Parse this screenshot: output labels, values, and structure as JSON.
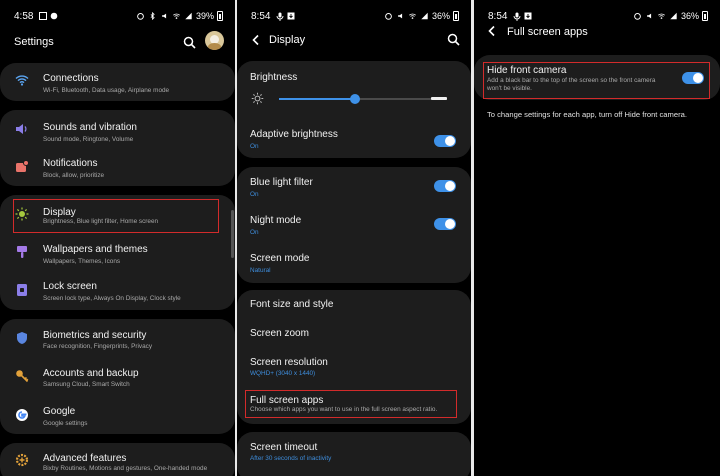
{
  "colors": {
    "accent": "#3e91e8",
    "highlight": "#d22b2b",
    "card": "#1d1d1d"
  },
  "panel1": {
    "status": {
      "time": "4:58",
      "battery": "39%"
    },
    "title": "Settings",
    "items": [
      {
        "title": "Connections",
        "subtitle": "Wi-Fi, Bluetooth, Data usage, Airplane mode",
        "icon": "wifi-icon"
      },
      {
        "title": "Sounds and vibration",
        "subtitle": "Sound mode, Ringtone, Volume",
        "icon": "volume-icon"
      },
      {
        "title": "Notifications",
        "subtitle": "Block, allow, prioritize",
        "icon": "notification-icon"
      },
      {
        "title": "Display",
        "subtitle": "Brightness, Blue light filter, Home screen",
        "icon": "sun-icon"
      },
      {
        "title": "Wallpapers and themes",
        "subtitle": "Wallpapers, Themes, Icons",
        "icon": "brush-icon"
      },
      {
        "title": "Lock screen",
        "subtitle": "Screen lock type, Always On Display, Clock style",
        "icon": "lock-icon"
      },
      {
        "title": "Biometrics and security",
        "subtitle": "Face recognition, Fingerprints, Privacy",
        "icon": "shield-icon"
      },
      {
        "title": "Accounts and backup",
        "subtitle": "Samsung Cloud, Smart Switch",
        "icon": "key-icon"
      },
      {
        "title": "Google",
        "subtitle": "Google settings",
        "icon": "google-icon"
      },
      {
        "title": "Advanced features",
        "subtitle": "Bixby Routines, Motions and gestures, One-handed mode",
        "icon": "gear-plus-icon"
      }
    ]
  },
  "panel2": {
    "status": {
      "time": "8:54",
      "battery": "36%"
    },
    "title": "Display",
    "brightness": {
      "label": "Brightness",
      "level": 0.45
    },
    "adaptive": {
      "title": "Adaptive brightness",
      "subtitle": "On"
    },
    "blue_light": {
      "title": "Blue light filter",
      "subtitle": "On"
    },
    "night_mode": {
      "title": "Night mode",
      "subtitle": "On"
    },
    "screen_mode": {
      "title": "Screen mode",
      "subtitle": "Natural"
    },
    "font_size": {
      "title": "Font size and style"
    },
    "screen_zoom": {
      "title": "Screen zoom"
    },
    "resolution": {
      "title": "Screen resolution",
      "subtitle": "WQHD+ (3040 x 1440)"
    },
    "full_screen": {
      "title": "Full screen apps",
      "subtitle": "Choose which apps you want to use in the full screen aspect ratio."
    },
    "timeout": {
      "title": "Screen timeout",
      "subtitle": "After 30 seconds of inactivity"
    }
  },
  "panel3": {
    "status": {
      "time": "8:54",
      "battery": "36%"
    },
    "title": "Full screen apps",
    "hide_camera": {
      "title": "Hide front camera",
      "subtitle_line1": "Add a black bar to the top of the screen so the front camera",
      "subtitle_line2": "won't be visible."
    },
    "note": "To change settings for each app, turn off Hide front camera."
  }
}
